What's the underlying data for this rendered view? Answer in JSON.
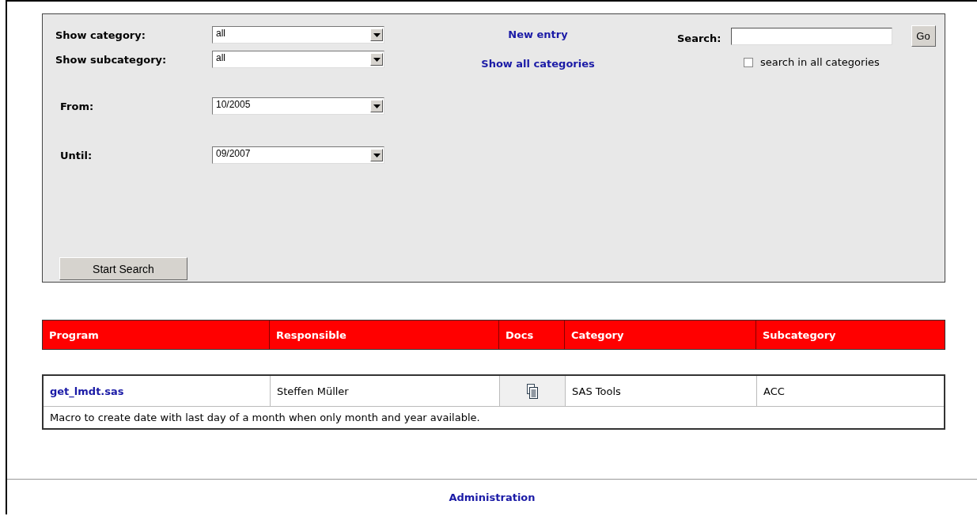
{
  "filters": [
    {
      "label": "Show category:",
      "value": "all"
    },
    {
      "label": "Show subcategory:",
      "value": "all"
    },
    {
      "label": "From:",
      "value": "10/2005"
    },
    {
      "label": "Until:",
      "value": "09/2007"
    }
  ],
  "links": [
    "New entry",
    "Show all categories"
  ],
  "search": {
    "label": "Search:",
    "button": "Go",
    "all_categories": {
      "label": "search in all categories",
      "checked": false
    }
  },
  "start_button": "Start Search",
  "table": {
    "columns": [
      "Program",
      "Responsible",
      "Docs",
      "Category",
      "Subcategory"
    ],
    "rows": [
      {
        "program": "get_lmdt.sas",
        "responsible": "Steffen Müller",
        "category": "SAS Tools",
        "subcategory": "ACC",
        "description": "Macro to create date with last day of a month when only month and year available."
      }
    ]
  },
  "footer_link": "Administration"
}
